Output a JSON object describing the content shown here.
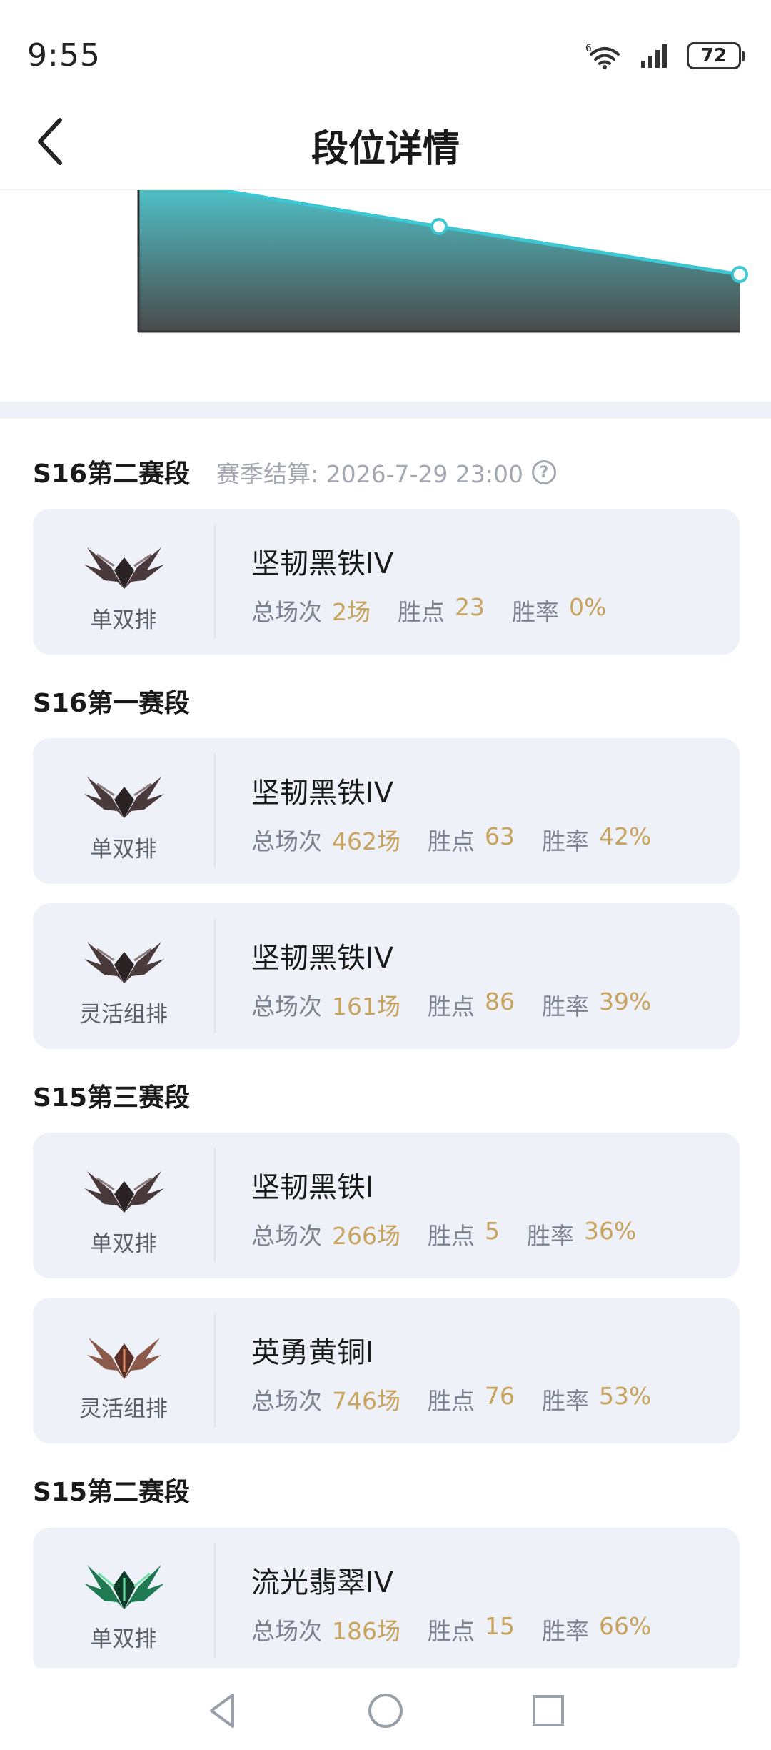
{
  "status_bar": {
    "time": "9:55",
    "battery": "72",
    "network_label": "6"
  },
  "header": {
    "title": "段位详情"
  },
  "colors": {
    "accent": "#3cc7d3",
    "value_gold": "#c8a35e",
    "card_bg": "#eef1f8"
  },
  "labels": {
    "total": "总场次",
    "points": "胜点",
    "winrate": "胜率"
  },
  "seasons": [
    {
      "title": "S16第二赛段",
      "meta": "赛季结算: 2026-7-29 23:00",
      "cards": [
        {
          "queue": "单双排",
          "rank": "坚韧黑铁IV",
          "total": "2场",
          "points": "23",
          "winrate": "0%",
          "emblem": "iron-emblem"
        }
      ]
    },
    {
      "title": "S16第一赛段",
      "cards": [
        {
          "queue": "单双排",
          "rank": "坚韧黑铁IV",
          "total": "462场",
          "points": "63",
          "winrate": "42%",
          "emblem": "iron-emblem"
        },
        {
          "queue": "灵活组排",
          "rank": "坚韧黑铁IV",
          "total": "161场",
          "points": "86",
          "winrate": "39%",
          "emblem": "iron-emblem"
        }
      ]
    },
    {
      "title": "S15第三赛段",
      "cards": [
        {
          "queue": "单双排",
          "rank": "坚韧黑铁I",
          "total": "266场",
          "points": "5",
          "winrate": "36%",
          "emblem": "iron-emblem"
        },
        {
          "queue": "灵活组排",
          "rank": "英勇黄铜I",
          "total": "746场",
          "points": "76",
          "winrate": "53%",
          "emblem": "bronze-emblem"
        }
      ]
    },
    {
      "title": "S15第二赛段",
      "cards": [
        {
          "queue": "单双排",
          "rank": "流光翡翠IV",
          "total": "186场",
          "points": "15",
          "winrate": "66%",
          "emblem": "emerald-emblem"
        }
      ]
    }
  ]
}
